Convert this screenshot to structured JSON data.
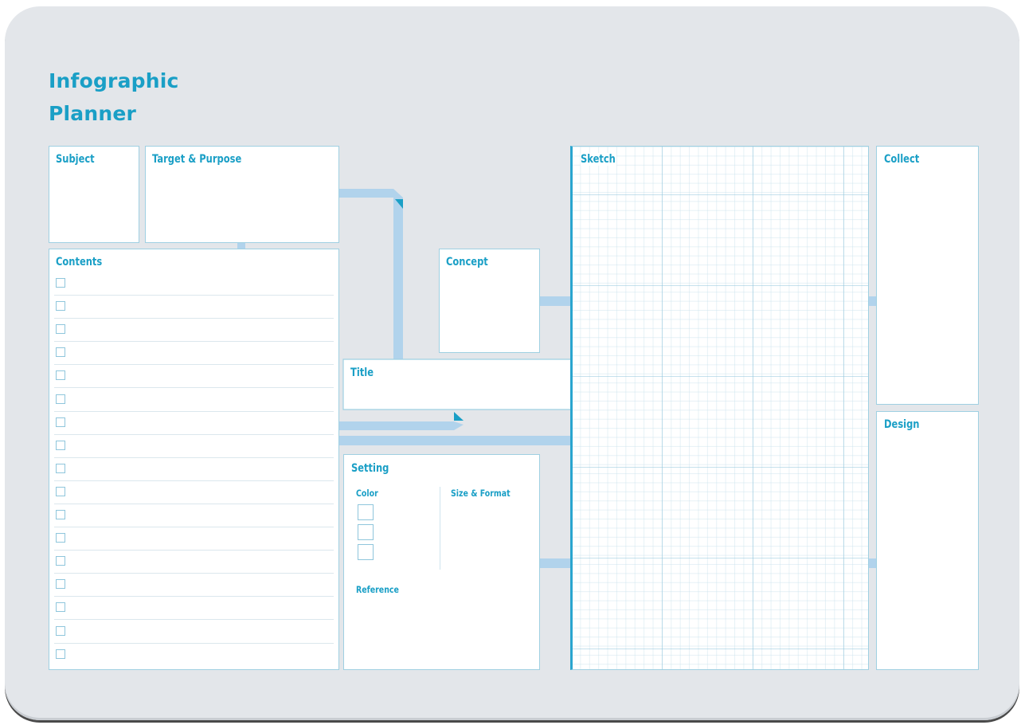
{
  "planner": {
    "title_line1": "Infographic",
    "title_line2": "Planner"
  },
  "sections": {
    "subject": "Subject",
    "target_purpose": "Target & Purpose",
    "contents": "Contents",
    "concept": "Concept",
    "title": "Title",
    "setting": "Setting",
    "color": "Color",
    "size_format": "Size & Format",
    "reference": "Reference",
    "sketch": "Sketch",
    "collect": "Collect",
    "design": "Design"
  },
  "contents_checkbox_count": 17,
  "color_swatch_count": 3,
  "colors": {
    "accent": "#1a9fc6",
    "connector": "#b1d3ec",
    "background": "#e3e6ea",
    "box_border": "#9fd0e2"
  }
}
